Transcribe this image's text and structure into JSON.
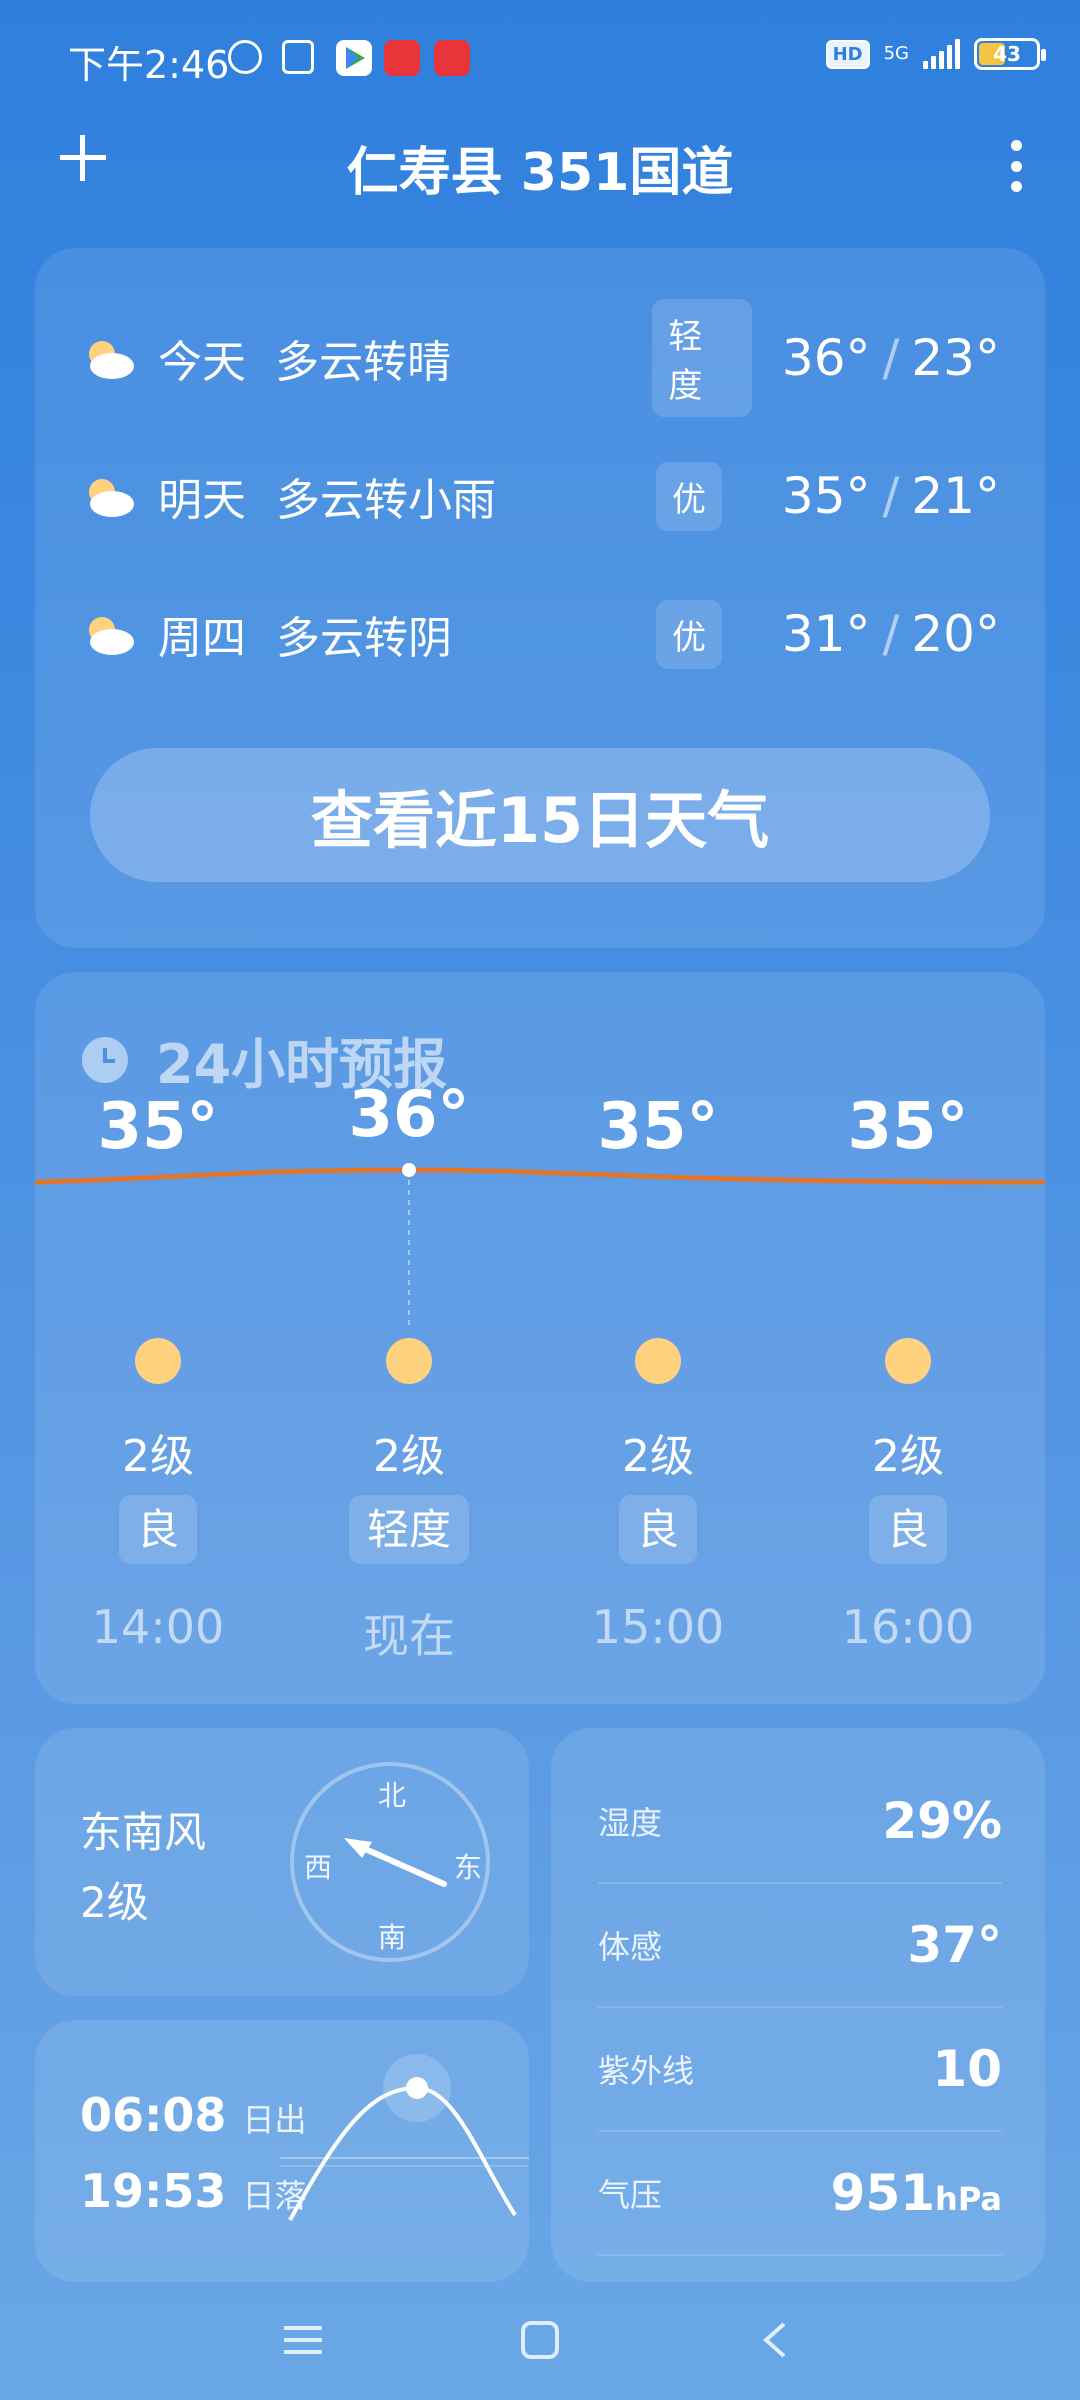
{
  "status_bar": {
    "time": "下午2:46",
    "network": "5G",
    "hd": "HD",
    "battery": "43",
    "battery_color": "#f4c542"
  },
  "header": {
    "location": "仁寿县 351国道",
    "add_icon": "plus-icon",
    "more_icon": "more-vertical-icon"
  },
  "forecast": [
    {
      "day": "今天",
      "condition": "多云转晴",
      "aqi": "轻度",
      "high": "36°",
      "low": "23°",
      "icon": "partly-cloudy-icon"
    },
    {
      "day": "明天",
      "condition": "多云转小雨",
      "aqi": "优",
      "high": "35°",
      "low": "21°",
      "icon": "partly-cloudy-icon"
    },
    {
      "day": "周四",
      "condition": "多云转阴",
      "aqi": "优",
      "high": "31°",
      "low": "20°",
      "icon": "partly-cloudy-icon"
    }
  ],
  "forecast_button": "查看近15日天气",
  "hourly": {
    "title": "24小时预报",
    "line_color": "#e0762e",
    "items": [
      {
        "temp": "35°",
        "wind": "2级",
        "aqi": "良",
        "time": "14:00"
      },
      {
        "temp": "36°",
        "wind": "2级",
        "aqi": "轻度",
        "time": "现在"
      },
      {
        "temp": "35°",
        "wind": "2级",
        "aqi": "良",
        "time": "15:00"
      },
      {
        "temp": "35°",
        "wind": "2级",
        "aqi": "良",
        "time": "16:00"
      }
    ]
  },
  "wind": {
    "direction": "东南风",
    "level": "2级",
    "compass": {
      "n": "北",
      "s": "南",
      "e": "东",
      "w": "西"
    }
  },
  "sun": {
    "sunrise": "06:08",
    "sunrise_label": "日出",
    "sunset": "19:53",
    "sunset_label": "日落"
  },
  "details": [
    {
      "label": "湿度",
      "value": "29%",
      "unit": ""
    },
    {
      "label": "体感",
      "value": "37°",
      "unit": ""
    },
    {
      "label": "紫外线",
      "value": "10",
      "unit": ""
    },
    {
      "label": "气压",
      "value": "951",
      "unit": "hPa"
    }
  ]
}
